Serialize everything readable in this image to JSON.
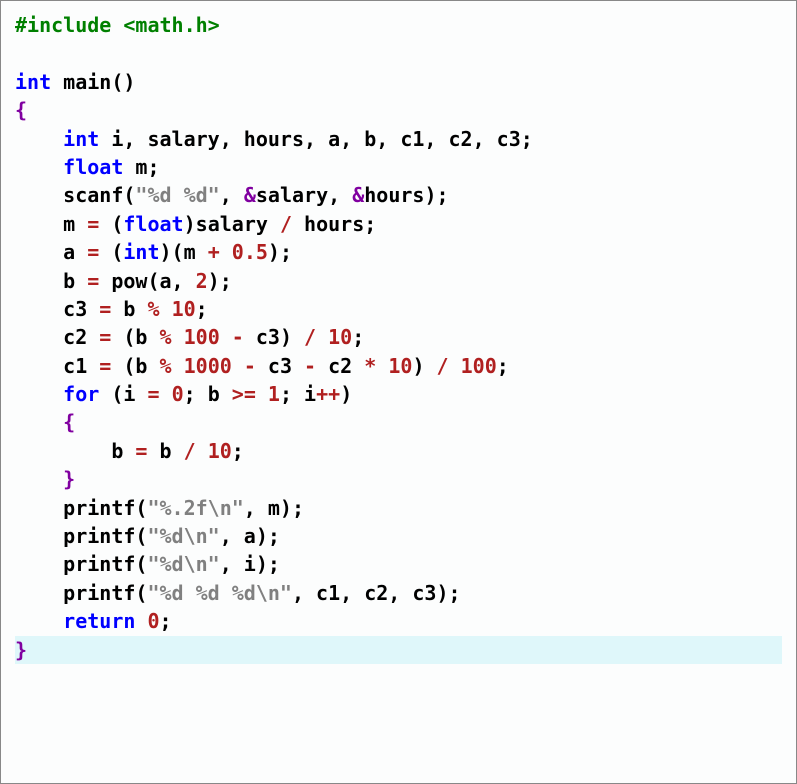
{
  "code": {
    "l1_include": "#include",
    "l1_lt": "<",
    "l1_header": "math.h",
    "l1_gt": ">",
    "blank": "",
    "l3_int": "int",
    "l3_main": " main",
    "l3_paren": "()",
    "l4_brace": "{",
    "l5_int": "int",
    "l5_rest": " i, salary, hours, a, b, c1, c2, c3;",
    "l6_float": "float",
    "l6_rest": " m;",
    "l7_scanf": "    scanf(",
    "l7_str": "\"%d %d\"",
    "l7_mid1": ", ",
    "l7_amp1": "&",
    "l7_v1": "salary, ",
    "l7_amp2": "&",
    "l7_v2": "hours);",
    "l8_a": "    m ",
    "l8_eq": "=",
    "l8_b": " (",
    "l8_float": "float",
    "l8_c": ")salary ",
    "l8_div": "/",
    "l8_d": " hours;",
    "l9_a": "    a ",
    "l9_eq": "=",
    "l9_b": " (",
    "l9_int": "int",
    "l9_c": ")(m ",
    "l9_plus": "+",
    "l9_d": " ",
    "l9_num": "0.5",
    "l9_e": ");",
    "l10_a": "    b ",
    "l10_eq": "=",
    "l10_b": " pow(a, ",
    "l10_num": "2",
    "l10_c": ");",
    "l11_a": "    c3 ",
    "l11_eq": "=",
    "l11_b": " b ",
    "l11_mod": "%",
    "l11_c": " ",
    "l11_num": "10",
    "l11_d": ";",
    "l12_a": "    c2 ",
    "l12_eq": "=",
    "l12_b": " (b ",
    "l12_mod": "%",
    "l12_c": " ",
    "l12_n1": "100",
    "l12_d": " ",
    "l12_minus": "-",
    "l12_e": " c3) ",
    "l12_div": "/",
    "l12_f": " ",
    "l12_n2": "10",
    "l12_g": ";",
    "l13_a": "    c1 ",
    "l13_eq": "=",
    "l13_b": " (b ",
    "l13_mod": "%",
    "l13_c": " ",
    "l13_n1": "1000",
    "l13_d": " ",
    "l13_m1": "-",
    "l13_e": " c3 ",
    "l13_m2": "-",
    "l13_f": " c2 ",
    "l13_mul": "*",
    "l13_g": " ",
    "l13_n2": "10",
    "l13_h": ") ",
    "l13_div": "/",
    "l13_i": " ",
    "l13_n3": "100",
    "l13_j": ";",
    "l14_for": "for",
    "l14_a": " (i ",
    "l14_eq1": "=",
    "l14_b": " ",
    "l14_z": "0",
    "l14_c": "; b ",
    "l14_ge": ">=",
    "l14_d": " ",
    "l14_one": "1",
    "l14_e": "; i",
    "l14_inc": "++",
    "l14_f": ")",
    "l15": "    {",
    "l16_a": "        b ",
    "l16_eq": "=",
    "l16_b": " b ",
    "l16_div": "/",
    "l16_c": " ",
    "l16_n": "10",
    "l16_d": ";",
    "l17": "    }",
    "l18_a": "    printf(",
    "l18_s": "\"%.2f\\n\"",
    "l18_b": ", m);",
    "l19_a": "    printf(",
    "l19_s": "\"%d\\n\"",
    "l19_b": ", a);",
    "l20_a": "    printf(",
    "l20_s": "\"%d\\n\"",
    "l20_b": ", i);",
    "l21_a": "    printf(",
    "l21_s": "\"%d %d %d\\n\"",
    "l21_b": ", c1, c2, c3);",
    "l22_ret": "return",
    "l22_sp": " ",
    "l22_z": "0",
    "l22_sc": ";",
    "l23": "}"
  }
}
